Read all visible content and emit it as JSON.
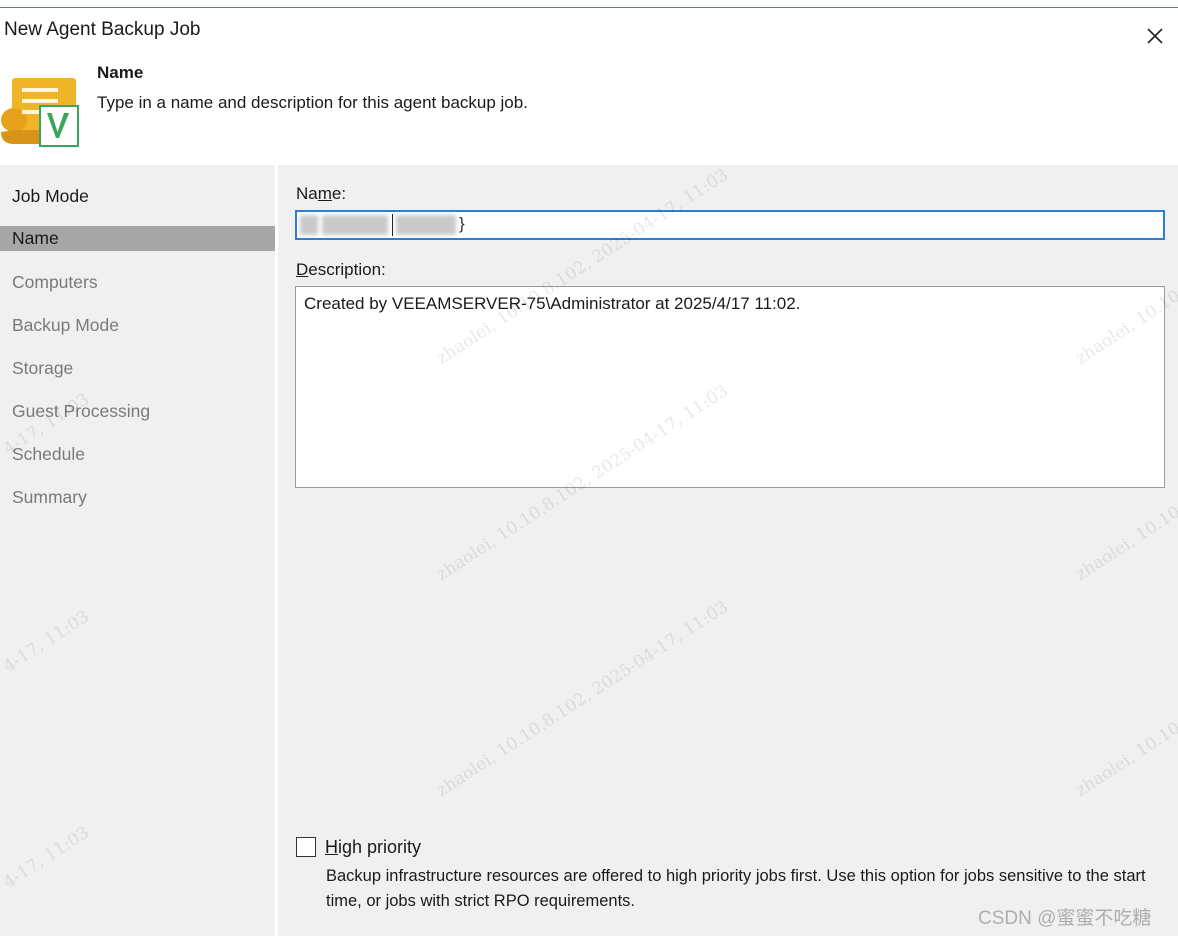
{
  "window": {
    "title": "New Agent Backup Job",
    "close_icon": "close-icon"
  },
  "header": {
    "icon": "scroll-v-icon",
    "title": "Name",
    "description": "Type in a name and description for this agent backup job."
  },
  "sidebar": {
    "items": [
      {
        "label": "Job Mode",
        "state": "done"
      },
      {
        "label": "Name",
        "state": "active"
      },
      {
        "label": "Computers",
        "state": "pending"
      },
      {
        "label": "Backup Mode",
        "state": "pending"
      },
      {
        "label": "Storage",
        "state": "pending"
      },
      {
        "label": "Guest Processing",
        "state": "pending"
      },
      {
        "label": "Schedule",
        "state": "pending"
      },
      {
        "label": "Summary",
        "state": "pending"
      }
    ]
  },
  "form": {
    "name_label_pre": "Na",
    "name_label_accel": "m",
    "name_label_post": "e:",
    "name_value_tail": "}",
    "description_label_accel": "D",
    "description_label_post": "escription:",
    "description_value": "Created by VEEAMSERVER-75\\Administrator at 2025/4/17 11:02.",
    "high_priority_accel": "H",
    "high_priority_label_post": "igh priority",
    "high_priority_checked": false,
    "high_priority_help": "Backup infrastructure resources are offered to high priority jobs first. Use this option for jobs sensitive to the start time, or jobs with strict RPO requirements."
  },
  "watermark": {
    "full": "zhaolei, 10.10.8.102, 2025-04-17, 11:03",
    "fragment_date": "4-17, 11:03",
    "fragment_user": "zhaolei, 10.10."
  },
  "corner_watermark": "CSDN @蜜蜜不吃糖",
  "colors": {
    "accent_focus": "#2d7cd6",
    "sidebar_active": "#a6a6a6",
    "panel_bg": "#f0f0f0",
    "icon_yellow": "#f0b429",
    "icon_green": "#3ba55c"
  }
}
